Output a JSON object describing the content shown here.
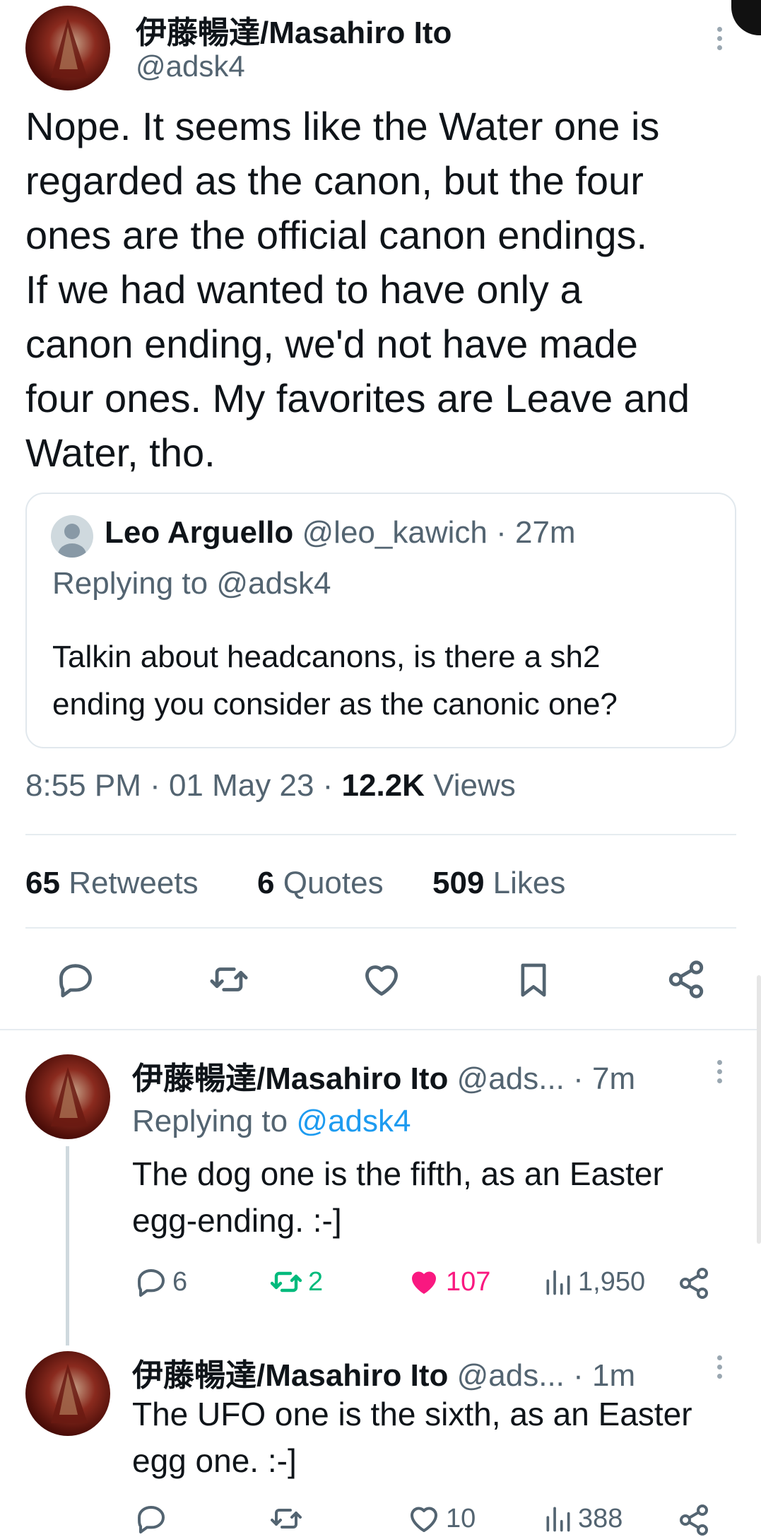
{
  "main_tweet": {
    "author_name": "伊藤暢達/Masahiro Ito",
    "author_handle": "@adsk4",
    "text_lines": [
      "Nope. It seems like the Water one is",
      "regarded as the canon, but the four",
      "ones are the official canon endings.",
      "If we had wanted to have only a",
      "canon ending, we'd not have made",
      "four ones. My favorites are Leave and",
      "Water, tho."
    ],
    "quoted": {
      "name": "Leo Arguello",
      "handle": "@leo_kawich",
      "time": "· 27m",
      "replying_to": "Replying to @adsk4",
      "text_lines": [
        "Talkin about headcanons, is there a sh2",
        "ending you consider as the canonic one?"
      ]
    },
    "timestamp": "8:55 PM · 01 May 23 · ",
    "views_count": "12.2K",
    "views_label": "Views",
    "stats": {
      "retweets_count": "65",
      "retweets_label": "Retweets",
      "quotes_count": "6",
      "quotes_label": "Quotes",
      "likes_count": "509",
      "likes_label": "Likes"
    }
  },
  "replies": [
    {
      "author_name": "伊藤暢達/Masahiro Ito",
      "author_handle": "@ads...",
      "time": "· 7m",
      "replying_prefix": "Replying to ",
      "replying_handle": "@adsk4",
      "text_lines": [
        "The dog one is the fifth, as an Easter",
        "egg-ending. :-]"
      ],
      "reply_count": "6",
      "retweet_count": "2",
      "like_count": "107",
      "view_count": "1,950"
    },
    {
      "author_name": "伊藤暢達/Masahiro Ito",
      "author_handle": "@ads...",
      "time": "· 1m",
      "text_lines": [
        "The UFO one is the sixth, as an Easter",
        "egg one. :-]"
      ],
      "reply_count": "",
      "retweet_count": "",
      "like_count": "10",
      "view_count": "388"
    }
  ],
  "colors": {
    "text": "#0f1419",
    "secondary": "#536471",
    "link": "#1d9bf0",
    "retweet_green": "#00ba7c",
    "like_pink": "#f91880"
  },
  "icons": {
    "main_actions": [
      "reply-icon",
      "retweet-icon",
      "like-icon",
      "bookmark-icon",
      "share-icon"
    ],
    "reply_actions": [
      "reply-icon",
      "retweet-icon",
      "like-icon",
      "views-icon",
      "share-icon"
    ]
  }
}
